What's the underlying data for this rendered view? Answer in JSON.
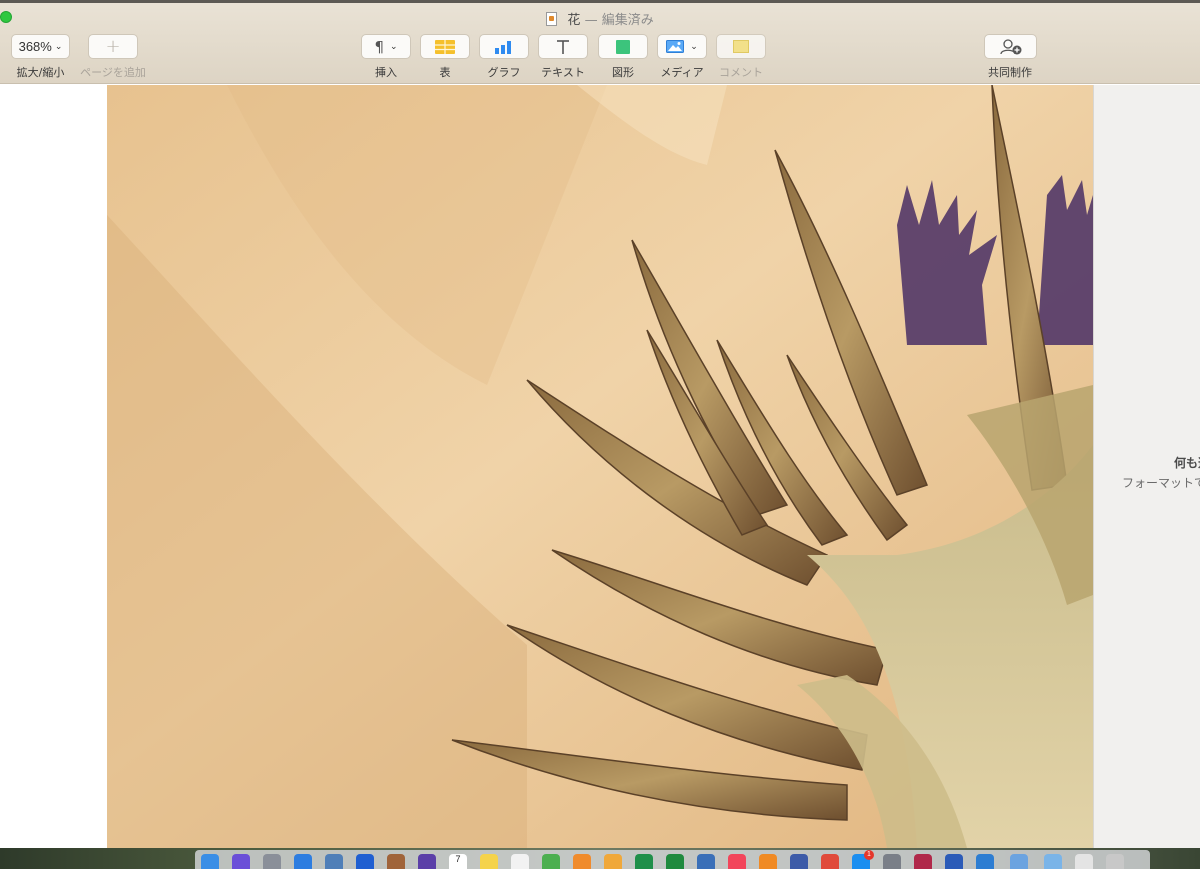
{
  "window": {
    "title": "花",
    "separator": "—",
    "status": "編集済み"
  },
  "toolbar": {
    "zoom_value": "368%",
    "zoom_label": "拡大/縮小",
    "add_page_label": "ページを追加",
    "insert_label": "挿入",
    "table_label": "表",
    "chart_label": "グラフ",
    "text_label": "テキスト",
    "shape_label": "図形",
    "media_label": "メディア",
    "comment_label": "コメント",
    "collaborate_label": "共同制作"
  },
  "sidebar": {
    "empty_title": "何も選",
    "empty_hint": "フォーマットで"
  },
  "colors": {
    "toolbar_bg": "#e4dccd",
    "accent_blue": "#2f8bf0",
    "table_yellow": "#f5c02c",
    "shape_green": "#3cc47c",
    "traffic_green": "#2fc840"
  },
  "dock": {
    "icons": [
      "finder-icon",
      "siri-icon",
      "launchpad-icon",
      "safari-icon",
      "preview-icon",
      "dropbox-icon",
      "notebook-icon",
      "imovie-icon",
      "calendar-icon",
      "notes-icon",
      "textedit-icon",
      "maps-icon",
      "photos-icon",
      "keynote-icon",
      "excel-icon",
      "numbers-icon",
      "remote-desktop-icon",
      "music-icon",
      "books-icon",
      "xcode-icon",
      "chrome-icon",
      "app-store-icon",
      "system-preferences-icon",
      "photo-booth-icon",
      "word-icon",
      "globe-icon",
      "folder-icon",
      "downloads-folder-icon",
      "documents-icon",
      "trash-icon"
    ],
    "app_store_badge": "1",
    "calendar_day": "7"
  }
}
